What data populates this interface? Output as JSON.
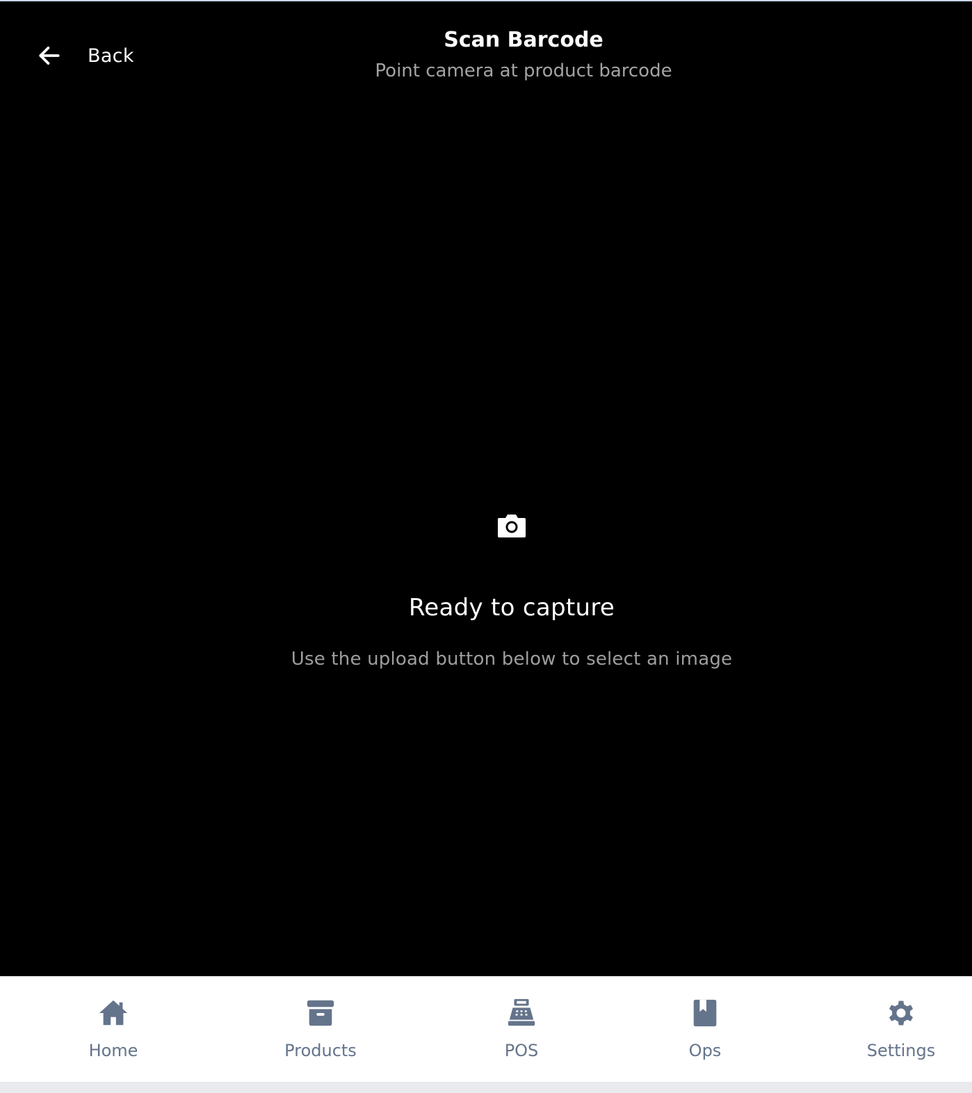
{
  "header": {
    "back_label": "Back",
    "title": "Scan Barcode",
    "subtitle": "Point camera at product barcode"
  },
  "scanner": {
    "icon": "camera-icon",
    "title": "Ready to capture",
    "message": "Use the upload button below to select an image"
  },
  "nav": {
    "items": [
      {
        "label": "Home",
        "icon": "home-icon"
      },
      {
        "label": "Products",
        "icon": "archive-box-icon"
      },
      {
        "label": "POS",
        "icon": "cash-register-icon"
      },
      {
        "label": "Ops",
        "icon": "book-icon"
      },
      {
        "label": "Settings",
        "icon": "gear-icon"
      }
    ]
  },
  "colors": {
    "background": "#000000",
    "nav_background": "#ffffff",
    "nav_icon": "#64748b",
    "subtitle": "#a3a3a3"
  }
}
